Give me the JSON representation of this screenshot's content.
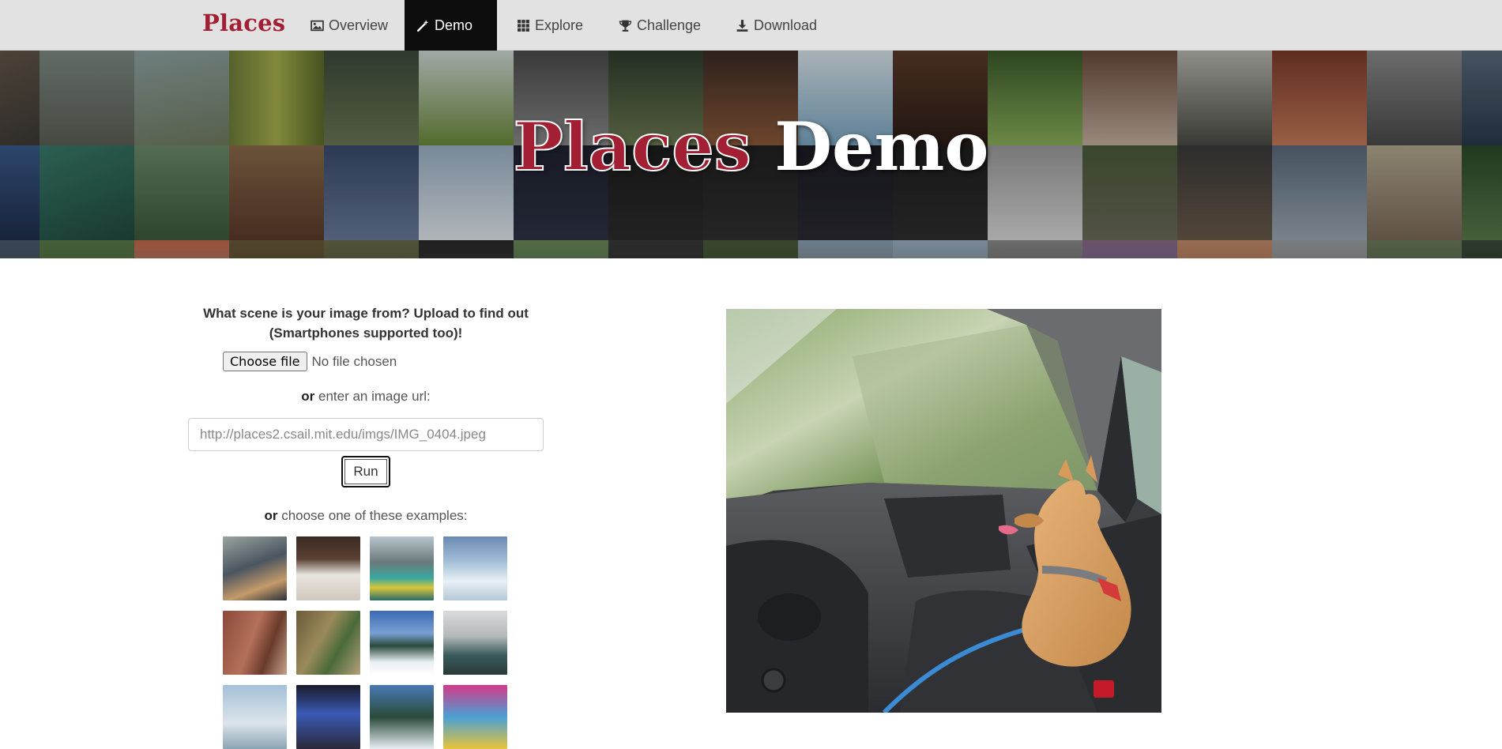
{
  "nav": {
    "brand": "Places",
    "items": [
      {
        "label": "Overview",
        "icon": "picture-icon"
      },
      {
        "label": "Demo",
        "icon": "magic-wand-icon",
        "active": true
      },
      {
        "label": "Explore",
        "icon": "grid-icon"
      },
      {
        "label": "Challenge",
        "icon": "trophy-icon"
      },
      {
        "label": "Download",
        "icon": "download-icon"
      }
    ]
  },
  "hero": {
    "title_accent": "Places",
    "title_rest": " Demo"
  },
  "upload": {
    "prompt_line1": "What scene is your image from? Upload to find out",
    "prompt_line2": "(Smartphones supported too)!",
    "file_button": "Choose file",
    "file_status": "No file chosen",
    "or_word": "or",
    "url_text": " enter an image url:",
    "url_placeholder": "http://places2.csail.mit.edu/imgs/IMG_0404.jpeg",
    "run_label": "Run",
    "examples_text": " choose one of these examples:"
  },
  "colors": {
    "brand": "#a31f34",
    "navbar_bg": "#e2e2e2",
    "nav_active_bg": "#0d0d0d"
  }
}
